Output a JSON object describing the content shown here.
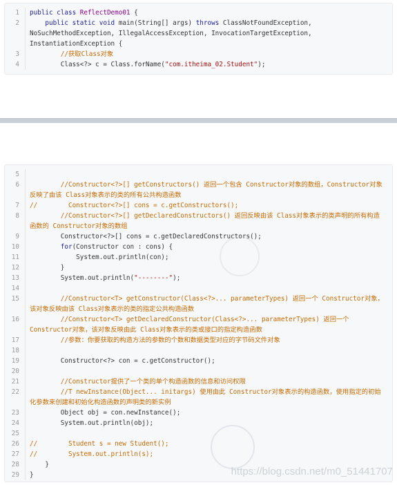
{
  "block1": {
    "lines": [
      {
        "n": "1",
        "segs": [
          {
            "t": "public class ",
            "c": "kw"
          },
          {
            "t": "ReflectDemo01",
            "c": "cls"
          },
          {
            "t": " {",
            "c": ""
          }
        ]
      },
      {
        "n": "2",
        "segs": [
          {
            "t": "    public static void ",
            "c": "kw"
          },
          {
            "t": "main(String[] args) ",
            "c": ""
          },
          {
            "t": "throws",
            "c": "kw"
          },
          {
            "t": " ClassNotFoundException, NoSuchMethodException, IllegalAccessException, InvocationTargetException, InstantiationException {",
            "c": ""
          }
        ]
      },
      {
        "n": "3",
        "segs": [
          {
            "t": "        //获取Class对象",
            "c": "comment"
          }
        ]
      },
      {
        "n": "4",
        "segs": [
          {
            "t": "        Class<?> c = Class.forName(",
            "c": ""
          },
          {
            "t": "\"com.itheima_02.Student\"",
            "c": "str"
          },
          {
            "t": ");",
            "c": ""
          }
        ]
      }
    ]
  },
  "block2": {
    "lines": [
      {
        "n": "5",
        "segs": [
          {
            "t": "",
            "c": ""
          }
        ]
      },
      {
        "n": "6",
        "segs": [
          {
            "t": "        //Constructor<?>[] getConstructors() 返回一个包含 Constructor对象的数组，Constructor对象反映了由该 Class对象表示的类的所有公共构造函数",
            "c": "comment"
          }
        ]
      },
      {
        "n": "7",
        "segs": [
          {
            "t": "//        Constructor<?>[] cons = c.getConstructors();",
            "c": "comment"
          }
        ]
      },
      {
        "n": "8",
        "segs": [
          {
            "t": "        //Constructor<?>[] getDeclaredConstructors() 返回反映由该 Class对象表示的类声明的所有构造函数的 Constructor对象的数组",
            "c": "comment"
          }
        ]
      },
      {
        "n": "9",
        "segs": [
          {
            "t": "        Constructor<?>[] cons = c.getDeclaredConstructors();",
            "c": ""
          }
        ]
      },
      {
        "n": "10",
        "segs": [
          {
            "t": "        ",
            "c": ""
          },
          {
            "t": "for",
            "c": "kw"
          },
          {
            "t": "(Constructor con : cons) {",
            "c": ""
          }
        ]
      },
      {
        "n": "11",
        "segs": [
          {
            "t": "            System.out.println(con);",
            "c": ""
          }
        ]
      },
      {
        "n": "12",
        "segs": [
          {
            "t": "        }",
            "c": ""
          }
        ]
      },
      {
        "n": "13",
        "segs": [
          {
            "t": "        System.out.println(",
            "c": ""
          },
          {
            "t": "\"--------\"",
            "c": "str"
          },
          {
            "t": ");",
            "c": ""
          }
        ]
      },
      {
        "n": "14",
        "segs": [
          {
            "t": "",
            "c": ""
          }
        ]
      },
      {
        "n": "15",
        "segs": [
          {
            "t": "        //Constructor<T> getConstructor(Class<?>... parameterTypes) 返回一个 Constructor对象，该对象反映由该 Class对象表示的类的指定公共构造函数",
            "c": "comment"
          }
        ]
      },
      {
        "n": "16",
        "segs": [
          {
            "t": "        //Constructor<T> getDeclaredConstructor(Class<?>... parameterTypes) 返回一个 Constructor对象，该对象反映由此 Class对象表示的类或接口的指定构造函数",
            "c": "comment"
          }
        ]
      },
      {
        "n": "17",
        "segs": [
          {
            "t": "        //参数：你要获取的构造方法的参数的个数和数据类型对应的字节码文件对象",
            "c": "comment"
          }
        ]
      },
      {
        "n": "18",
        "segs": [
          {
            "t": "",
            "c": ""
          }
        ]
      },
      {
        "n": "19",
        "segs": [
          {
            "t": "        Constructor<?> con = c.getConstructor();",
            "c": ""
          }
        ]
      },
      {
        "n": "20",
        "segs": [
          {
            "t": "",
            "c": ""
          }
        ]
      },
      {
        "n": "21",
        "segs": [
          {
            "t": "        //Constructor提供了一个类的单个构造函数的信息和访问权限",
            "c": "comment"
          }
        ]
      },
      {
        "n": "22",
        "segs": [
          {
            "t": "        //T newInstance(Object... initargs) 使用由此 Constructor对象表示的构造函数，使用指定的初始化参数来创建和初始化构造函数的声明类的新实例",
            "c": "comment"
          }
        ]
      },
      {
        "n": "23",
        "segs": [
          {
            "t": "        Object obj = con.newInstance();",
            "c": ""
          }
        ]
      },
      {
        "n": "24",
        "segs": [
          {
            "t": "        System.out.println(obj);",
            "c": ""
          }
        ]
      },
      {
        "n": "25",
        "segs": [
          {
            "t": "",
            "c": ""
          }
        ]
      },
      {
        "n": "26",
        "segs": [
          {
            "t": "//        Student s = new Student();",
            "c": "comment"
          }
        ]
      },
      {
        "n": "27",
        "segs": [
          {
            "t": "//        System.out.println(s);",
            "c": "comment"
          }
        ]
      },
      {
        "n": "28",
        "segs": [
          {
            "t": "    }",
            "c": ""
          }
        ]
      },
      {
        "n": "29",
        "segs": [
          {
            "t": "}",
            "c": ""
          }
        ]
      }
    ]
  },
  "watermark": "https://blog.csdn.net/m0_51441707"
}
